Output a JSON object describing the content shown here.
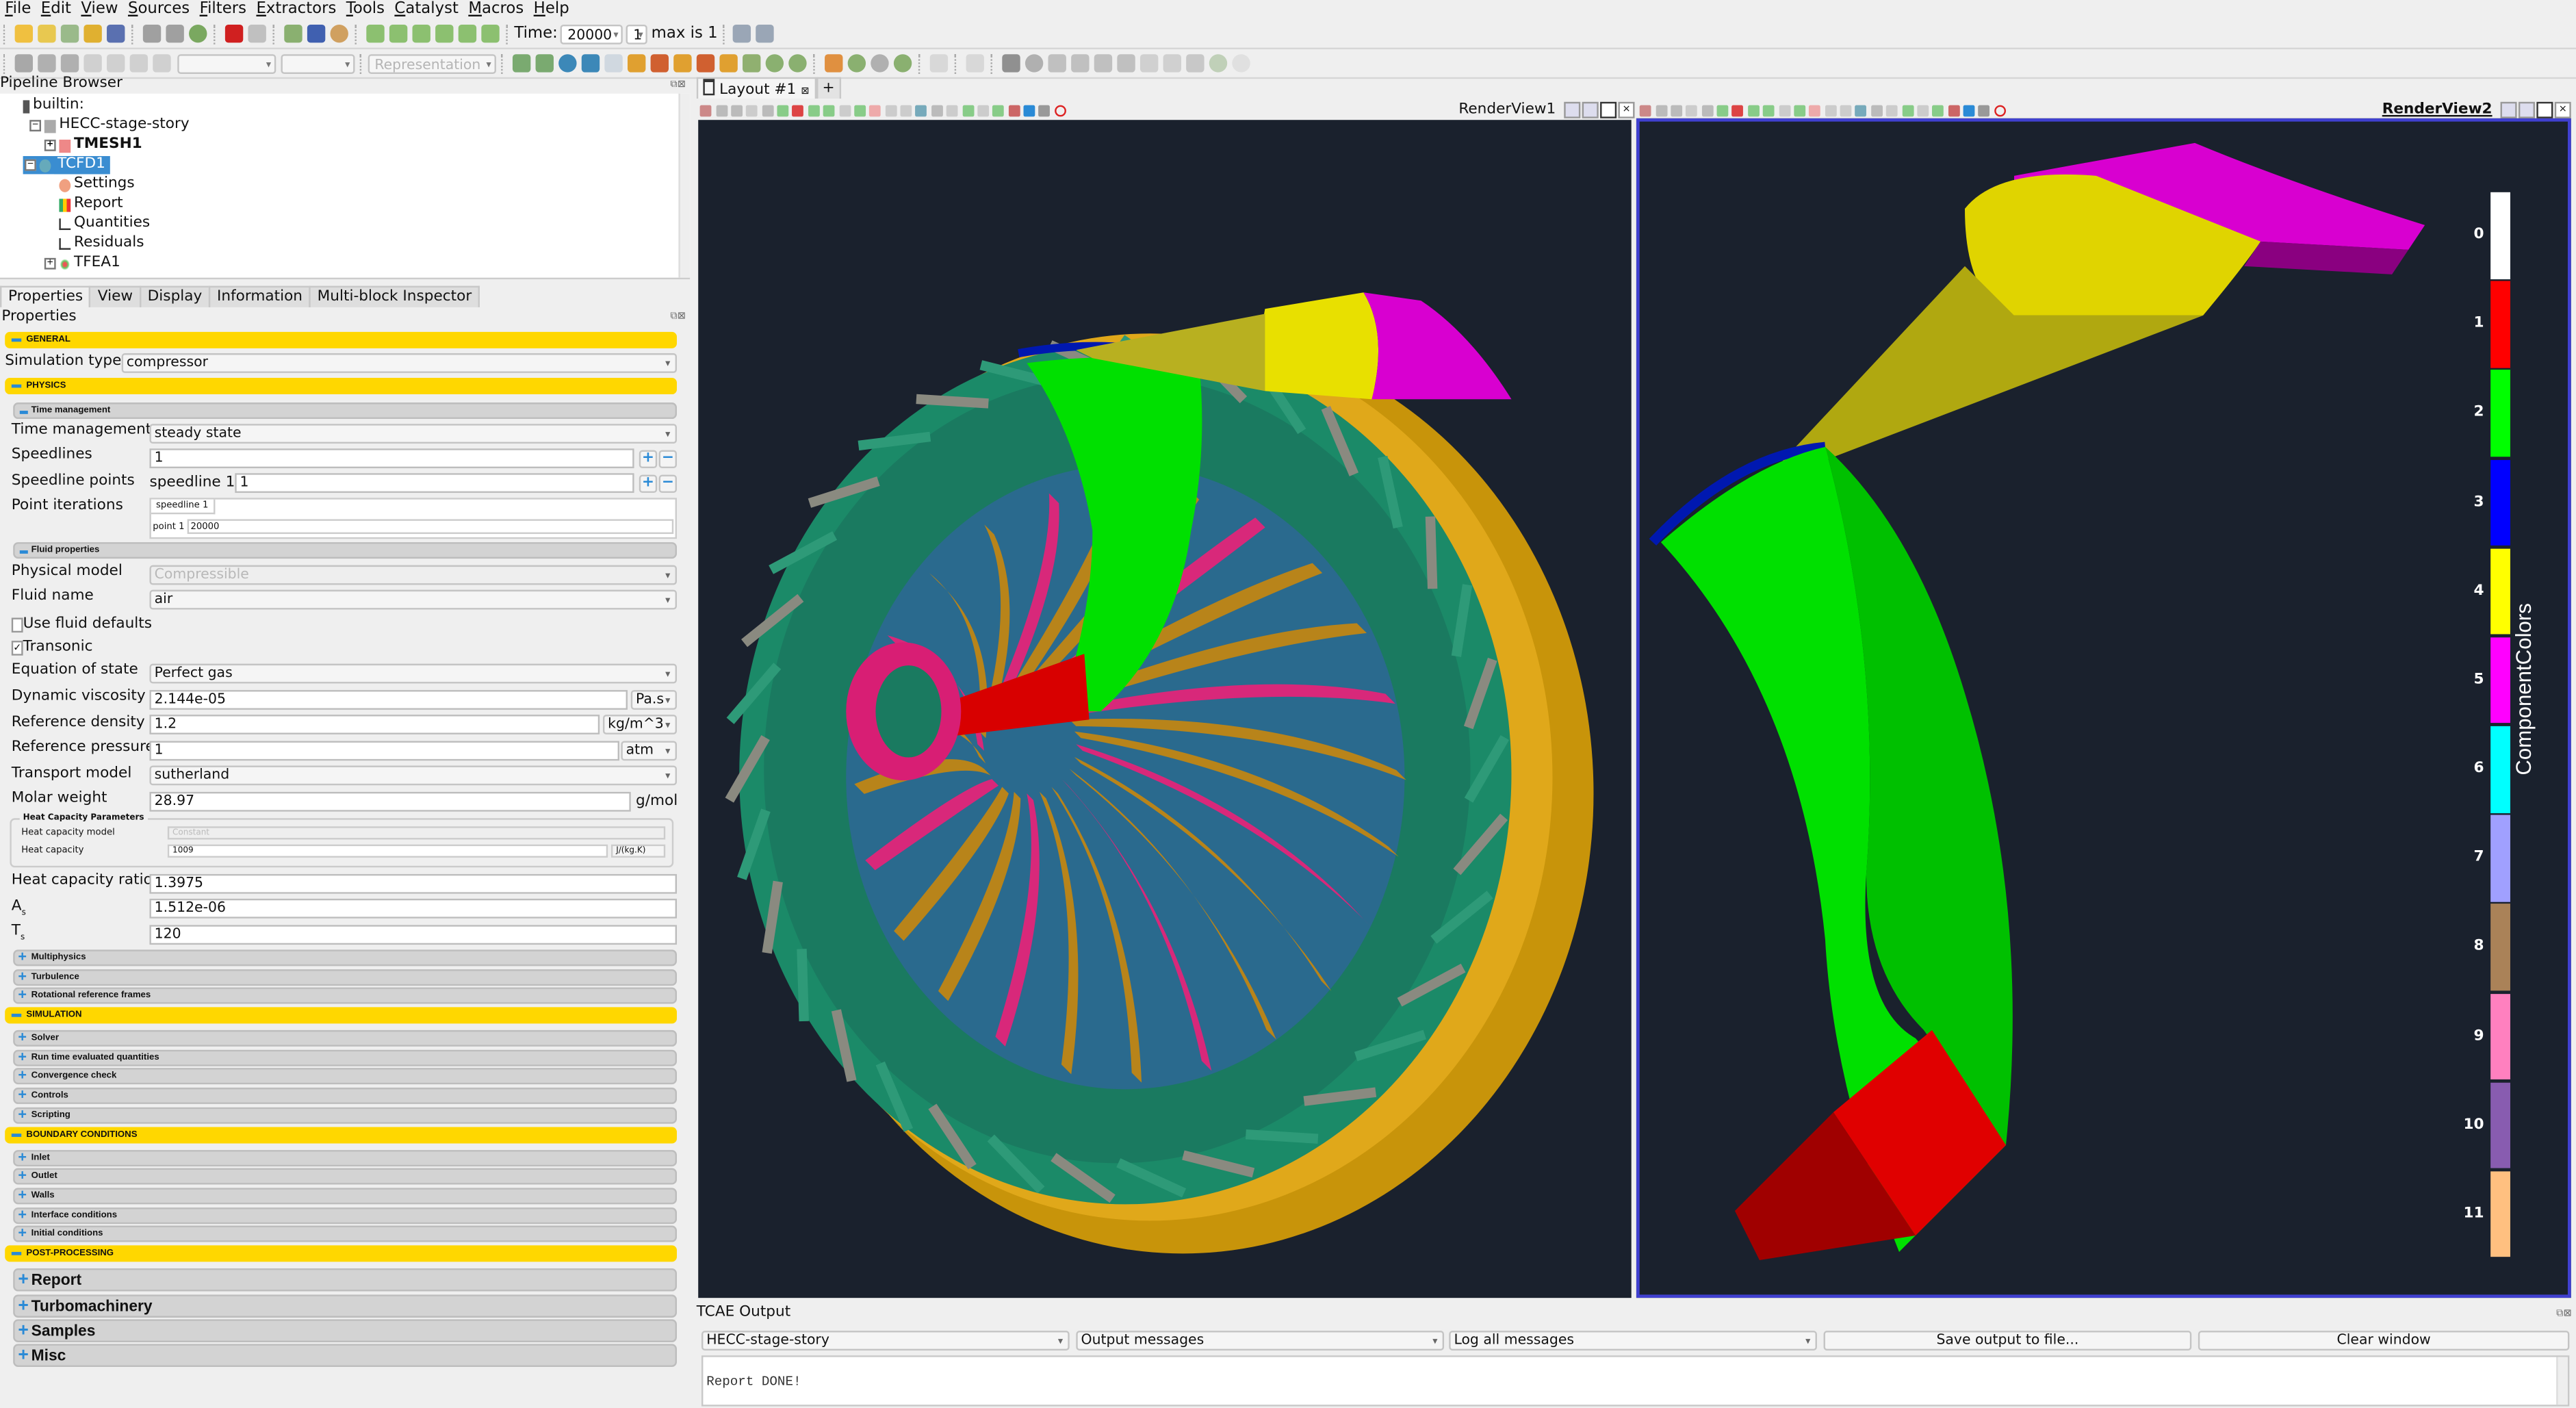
{
  "menu": [
    "File",
    "Edit",
    "View",
    "Sources",
    "Filters",
    "Extractors",
    "Tools",
    "Catalyst",
    "Macros",
    "Help"
  ],
  "toolbar": {
    "time_label": "Time:",
    "time_value": "20000",
    "timestep_value": "1",
    "max_label": "max is 1",
    "representation_placeholder": "Representation"
  },
  "pipeline": {
    "title": "Pipeline Browser",
    "items": [
      {
        "label": "builtin:",
        "icon": "server-icon"
      },
      {
        "label": "HECC-stage-story",
        "icon": "dataset-icon"
      },
      {
        "label": "TMESH1",
        "icon": "mesh-icon"
      },
      {
        "label": "TCFD1",
        "icon": "cfd-icon",
        "selected": true
      },
      {
        "label": "Settings",
        "icon": "settings-icon"
      },
      {
        "label": "Report",
        "icon": "bar-chart-icon"
      },
      {
        "label": "Quantities",
        "icon": "line-chart-icon"
      },
      {
        "label": "Residuals",
        "icon": "line-chart-icon"
      },
      {
        "label": "TFEA1",
        "icon": "fea-icon"
      }
    ]
  },
  "panel_tabs": [
    "Properties",
    "View",
    "Display",
    "Information",
    "Multi-block Inspector"
  ],
  "properties": {
    "title": "Properties",
    "sections": {
      "general": "GENERAL",
      "physics": "PHYSICS",
      "simulation": "SIMULATION",
      "boundary": "BOUNDARY CONDITIONS",
      "post": "POST-PROCESSING"
    },
    "simulation_type": {
      "label": "Simulation type",
      "value": "compressor"
    },
    "time_mgmt_group": "Time management",
    "time_management": {
      "label": "Time management",
      "value": "steady state"
    },
    "speedlines": {
      "label": "Speedlines",
      "value": "1"
    },
    "speedline_points": {
      "label": "Speedline points",
      "prefix": "speedline 1",
      "value": "1"
    },
    "point_iterations": {
      "label": "Point iterations",
      "tab": "speedline 1",
      "point_label": "point 1",
      "value": "20000"
    },
    "fluid_group": "Fluid properties",
    "physical_model": {
      "label": "Physical model",
      "value": "Compressible"
    },
    "fluid_name": {
      "label": "Fluid name",
      "value": "air"
    },
    "use_fluid_defaults": {
      "label": "Use fluid defaults",
      "checked": false
    },
    "transonic": {
      "label": "Transonic",
      "checked": true,
      "mark": "✓"
    },
    "equation_of_state": {
      "label": "Equation of state",
      "value": "Perfect gas"
    },
    "dynamic_viscosity": {
      "label": "Dynamic viscosity",
      "value": "2.144e-05",
      "unit": "Pa.s"
    },
    "reference_density": {
      "label": "Reference density",
      "value": "1.2",
      "unit": "kg/m^3"
    },
    "reference_pressure": {
      "label": "Reference pressure",
      "value": "1",
      "unit": "atm"
    },
    "transport_model": {
      "label": "Transport model",
      "value": "sutherland"
    },
    "molar_weight": {
      "label": "Molar weight",
      "value": "28.97",
      "unit": "g/mol"
    },
    "heat_capacity_params": {
      "title": "Heat Capacity Parameters",
      "model_label": "Heat capacity model",
      "model_value": "Constant",
      "capacity_label": "Heat capacity",
      "capacity_value": "1009",
      "capacity_unit": "J/(kg.K)"
    },
    "heat_capacity_ratio": {
      "label": "Heat capacity ratio",
      "value": "1.3975"
    },
    "as": {
      "label": "A",
      "sub": "s",
      "value": "1.512e-06"
    },
    "ts": {
      "label": "T",
      "sub": "s",
      "value": "120"
    },
    "physics_groups": [
      "Multiphysics",
      "Turbulence",
      "Rotational reference frames"
    ],
    "simulation_groups": [
      "Solver",
      "Run time evaluated quantities",
      "Convergence check",
      "Controls",
      "Scripting"
    ],
    "boundary_groups": [
      "Inlet",
      "Outlet",
      "Walls",
      "Interface conditions",
      "Initial conditions"
    ],
    "post_groups": [
      "Report",
      "Turbomachinery",
      "Samples",
      "Misc"
    ]
  },
  "layout": {
    "tab_label": "Layout #1",
    "add_tab": "+",
    "view1_title": "RenderView1",
    "view2_title": "RenderView2"
  },
  "legend": {
    "title": "ComponentColors",
    "entries": [
      {
        "label": "0",
        "color": "#ffffff"
      },
      {
        "label": "1",
        "color": "#ff0000"
      },
      {
        "label": "2",
        "color": "#00ff00"
      },
      {
        "label": "3",
        "color": "#0000ff"
      },
      {
        "label": "4",
        "color": "#ffff00"
      },
      {
        "label": "5",
        "color": "#ff00ff"
      },
      {
        "label": "6",
        "color": "#00ffff"
      },
      {
        "label": "7",
        "color": "#a0a0ff"
      },
      {
        "label": "8",
        "color": "#aa8258"
      },
      {
        "label": "9",
        "color": "#ff80bf"
      },
      {
        "label": "10",
        "color": "#885cb0"
      },
      {
        "label": "11",
        "color": "#ffc080"
      }
    ]
  },
  "output": {
    "title": "TCAE Output",
    "source": "HECC-stage-story",
    "type": "Output messages",
    "level": "Log all messages",
    "save_button": "Save output to file...",
    "clear_button": "Clear window",
    "log_text": "Report DONE!"
  },
  "colors": {
    "section_yellow": "#ffd700",
    "selection_blue": "#3a8dd1",
    "render_background": "#1a212d",
    "active_view_border": "#4040d0"
  }
}
